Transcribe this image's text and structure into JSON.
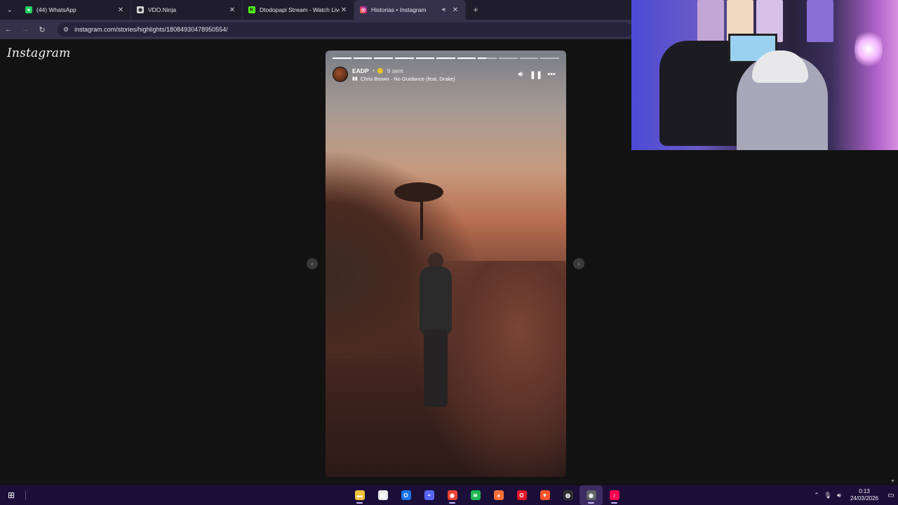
{
  "browser": {
    "tabs": [
      {
        "title": "(44) WhatsApp",
        "favicon": "whatsapp-icon",
        "color": "#25d366",
        "glyph": "44"
      },
      {
        "title": "VDO.Ninja",
        "favicon": "vdoninja-icon",
        "color": "#e6e6e6",
        "glyph": "◉"
      },
      {
        "title": "Dtodopapi Stream - Watch Live",
        "favicon": "kick-icon",
        "color": "#53fc18",
        "glyph": "K"
      },
      {
        "title": "Historias • Instagram",
        "favicon": "instagram-icon",
        "color": "#e1306c",
        "glyph": "◎"
      }
    ],
    "url": "instagram.com/stories/highlights/18084930478950554/"
  },
  "page": {
    "logo_text": "Instagram"
  },
  "story": {
    "username": "EADP",
    "time_ago": "9 sem",
    "song": "Chris Brown · No Guidance (feat. Drake)",
    "segments_done": 7,
    "segments_total": 11,
    "current_progress": 0.45
  },
  "taskbar": {
    "apps": [
      {
        "name": "file-explorer-icon",
        "color": "#f3c13a",
        "glyph": "▬"
      },
      {
        "name": "microsoft-store-icon",
        "color": "#e9e9e9",
        "glyph": "▦"
      },
      {
        "name": "outlook-icon",
        "color": "#1a73e8",
        "glyph": "O"
      },
      {
        "name": "discord-icon",
        "color": "#5865f2",
        "glyph": "◓"
      },
      {
        "name": "chrome-icon",
        "color": "#ea4335",
        "glyph": "◉"
      },
      {
        "name": "spotify-icon",
        "color": "#1db954",
        "glyph": "≋"
      },
      {
        "name": "firefox-icon",
        "color": "#ff7139",
        "glyph": "◕"
      },
      {
        "name": "opera-icon",
        "color": "#e0162b",
        "glyph": "O"
      },
      {
        "name": "brave-icon",
        "color": "#fb542b",
        "glyph": "▼"
      },
      {
        "name": "obs-icon",
        "color": "#302e31",
        "glyph": "◍"
      },
      {
        "name": "chrome-canary-icon",
        "color": "#5f6368",
        "glyph": "◉"
      },
      {
        "name": "tiktok-icon",
        "color": "#ff0050",
        "glyph": "♪"
      }
    ],
    "time": "0:13",
    "date": "24/03/2026"
  }
}
